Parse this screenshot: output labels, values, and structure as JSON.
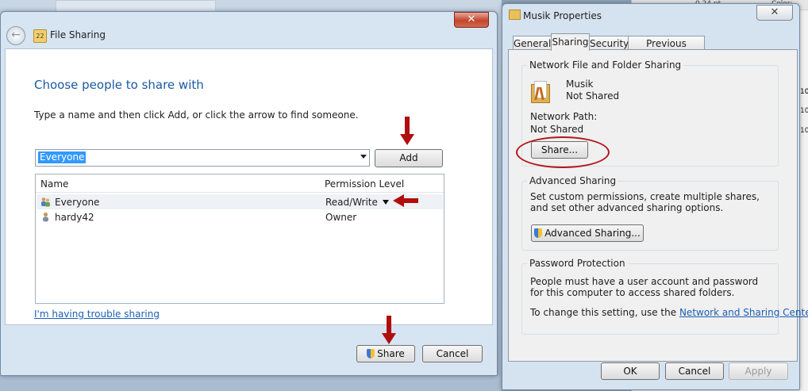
{
  "background": {
    "format_value": "0.24 pt",
    "color_label": "Color:",
    "cell_values": [
      "10",
      "10",
      "10"
    ]
  },
  "file_sharing": {
    "window_title": "File Sharing",
    "close_glyph": "✕",
    "heading": "Choose people to share with",
    "instruction": "Type a name and then click Add, or click the arrow to find someone.",
    "name_input_value": "Everyone",
    "add_label": "Add",
    "columns": {
      "name": "Name",
      "permission": "Permission Level"
    },
    "rows": [
      {
        "name": "Everyone",
        "permission": "Read/Write",
        "icon": "group-users-icon",
        "selected": true
      },
      {
        "name": "hardy42",
        "permission": "Owner",
        "icon": "user-icon",
        "selected": false
      }
    ],
    "trouble_link": "I'm having trouble sharing",
    "share_label": "Share",
    "cancel_label": "Cancel"
  },
  "properties": {
    "window_title": "Musik Properties",
    "close_glyph": "✕",
    "tabs": [
      "General",
      "Sharing",
      "Security",
      "Previous Versions"
    ],
    "active_tab": "Sharing",
    "network_section": {
      "title": "Network File and Folder Sharing",
      "folder_name": "Musik",
      "folder_status": "Not Shared",
      "network_path_label": "Network Path:",
      "network_path_value": "Not Shared",
      "share_button": "Share..."
    },
    "advanced_section": {
      "title": "Advanced Sharing",
      "description": "Set custom permissions, create multiple shares, and set other advanced sharing options.",
      "button": "Advanced Sharing..."
    },
    "password_section": {
      "title": "Password Protection",
      "description": "People must have a user account and password for this computer to access shared folders.",
      "change_prefix": "To change this setting, use the",
      "change_link": "Network and Sharing Center",
      "change_suffix": "."
    },
    "ok_label": "OK",
    "cancel_label": "Cancel",
    "apply_label": "Apply"
  },
  "colors": {
    "annotation_red": "#b00d0d",
    "heading_blue": "#1b5aa0",
    "link_blue": "#1c5fb6",
    "selection_blue": "#3399ff"
  }
}
